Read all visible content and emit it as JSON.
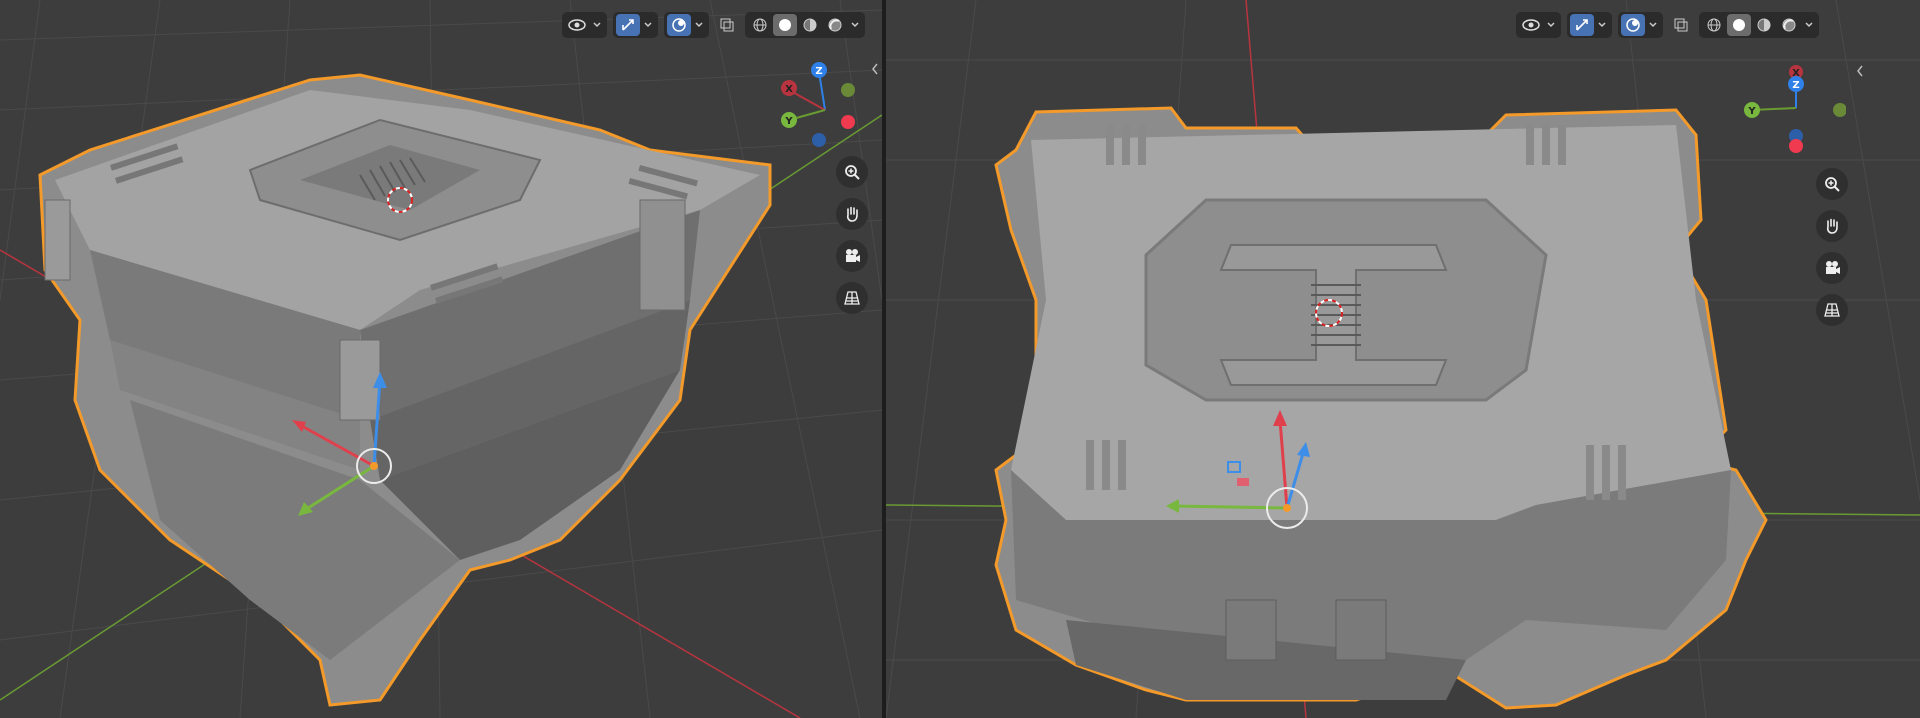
{
  "colors": {
    "viewport_bg": "#3d3d3d",
    "grid_line": "#4a4a4a",
    "axis_x": "#b8343f",
    "axis_y": "#6a9b33",
    "axis_z": "#2f80e8",
    "selection_outline": "#f39a2a",
    "model_surface": "#8c8c8c",
    "toolbar_bg": "#2b2b2b",
    "active_button": "#4772b3"
  },
  "viewports": [
    {
      "name": "left",
      "gizmo": {
        "x_label": "X",
        "y_label": "Y",
        "z_label": "Z"
      },
      "toolbar": {
        "icons": [
          "visibility-icon",
          "gizmo-icon",
          "overlays-icon",
          "xray-icon",
          "wireframe-shading-icon",
          "solid-shading-icon",
          "material-shading-icon",
          "rendered-shading-icon"
        ],
        "active_shading": "solid"
      },
      "nav": [
        "zoom-icon",
        "pan-hand-icon",
        "camera-icon",
        "perspective-grid-icon"
      ]
    },
    {
      "name": "right",
      "gizmo": {
        "x_label": "X",
        "y_label": "Y",
        "z_label": "Z"
      },
      "toolbar": {
        "icons": [
          "visibility-icon",
          "gizmo-icon",
          "overlays-icon",
          "xray-icon",
          "wireframe-shading-icon",
          "solid-shading-icon",
          "material-shading-icon",
          "rendered-shading-icon"
        ],
        "active_shading": "solid"
      },
      "nav": [
        "zoom-icon",
        "pan-hand-icon",
        "camera-icon",
        "perspective-grid-icon"
      ]
    }
  ]
}
